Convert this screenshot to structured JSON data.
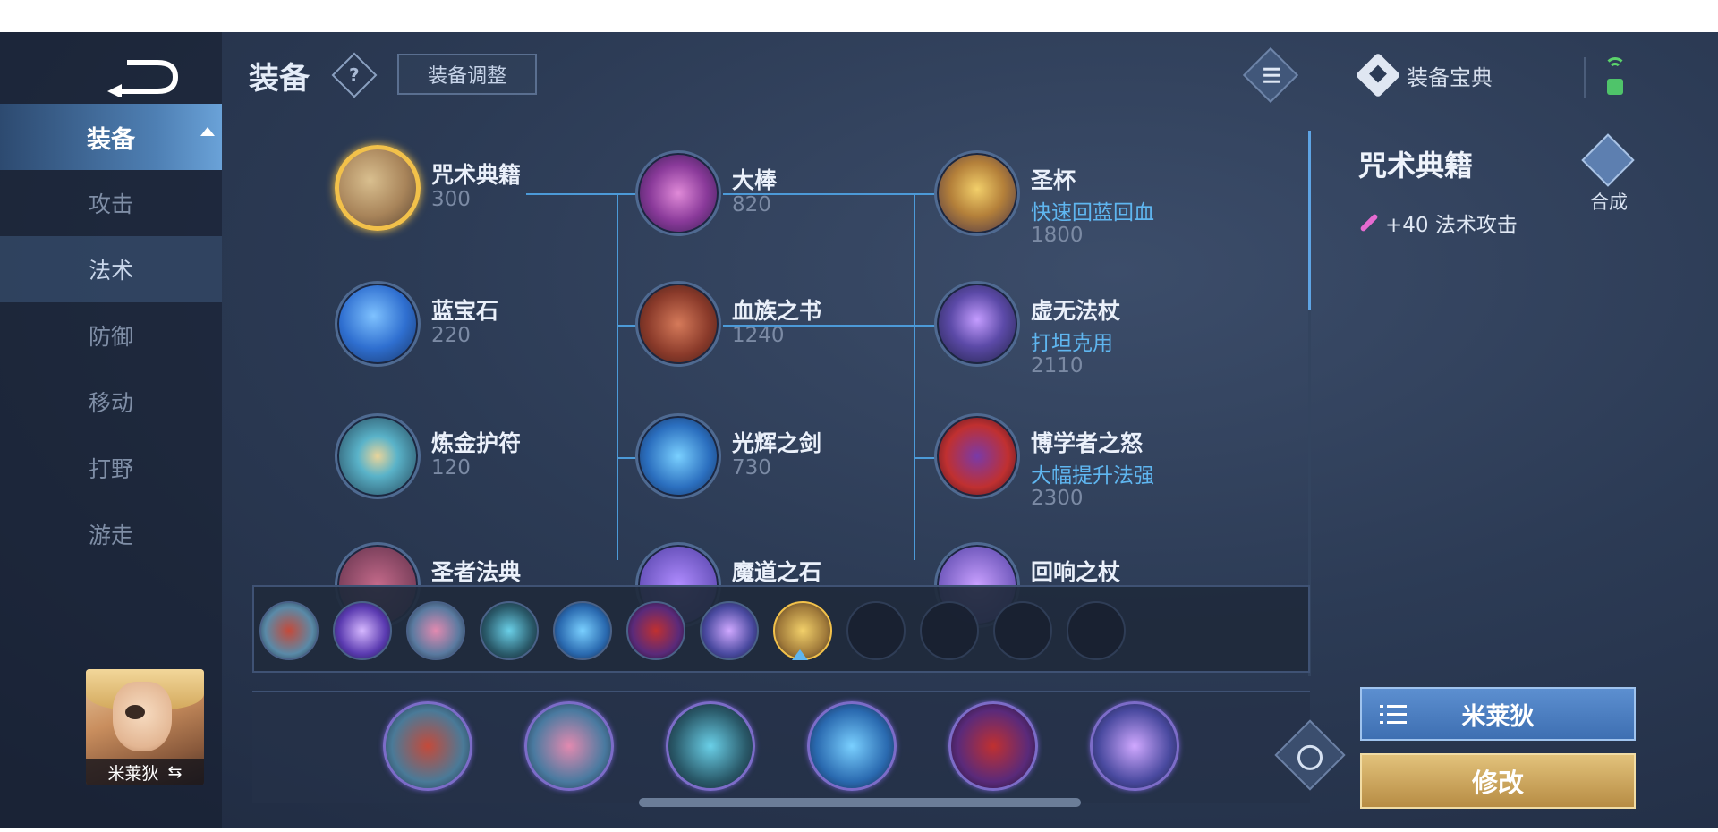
{
  "header": {
    "title": "装备",
    "help_icon": "question-diamond-icon",
    "adjust_button": "装备调整",
    "codex_label": "装备宝典"
  },
  "sidebar": {
    "items": [
      {
        "label": "装备",
        "state": "header-active"
      },
      {
        "label": "攻击"
      },
      {
        "label": "法术",
        "state": "selected"
      },
      {
        "label": "防御"
      },
      {
        "label": "移动"
      },
      {
        "label": "打野"
      },
      {
        "label": "游走"
      }
    ],
    "hero_name": "米莱狄",
    "swap_symbol": "⇆"
  },
  "tree": {
    "col1": [
      {
        "name": "咒术典籍",
        "price": "300",
        "selected": true
      },
      {
        "name": "蓝宝石",
        "price": "220"
      },
      {
        "name": "炼金护符",
        "price": "120"
      },
      {
        "name": "圣者法典",
        "price": ""
      }
    ],
    "col2": [
      {
        "name": "大棒",
        "price": "820"
      },
      {
        "name": "血族之书",
        "price": "1240"
      },
      {
        "name": "光辉之剑",
        "price": "730"
      },
      {
        "name": "魔道之石",
        "price": ""
      }
    ],
    "col3": [
      {
        "name": "圣杯",
        "desc": "快速回蓝回血",
        "price": "1800"
      },
      {
        "name": "虚无法杖",
        "desc": "打坦克用",
        "price": "2110"
      },
      {
        "name": "博学者之怒",
        "desc": "大幅提升法强",
        "price": "2300"
      },
      {
        "name": "回响之杖",
        "desc": "",
        "price": ""
      }
    ]
  },
  "quick_bar": {
    "filled_slots": 8,
    "empty_slots": 4
  },
  "build": {
    "slots": [
      "boots",
      "mask",
      "staff",
      "orb",
      "hat",
      "void-staff"
    ]
  },
  "detail": {
    "title": "咒术典籍",
    "compose_label": "合成",
    "stat": "+40 法术攻击"
  },
  "actions": {
    "hero_button": "米莱狄",
    "modify_button": "修改"
  },
  "colors": {
    "accent_blue": "#5fb6f0",
    "gold": "#f2c14a",
    "modify_gold": "#d1ac62"
  }
}
